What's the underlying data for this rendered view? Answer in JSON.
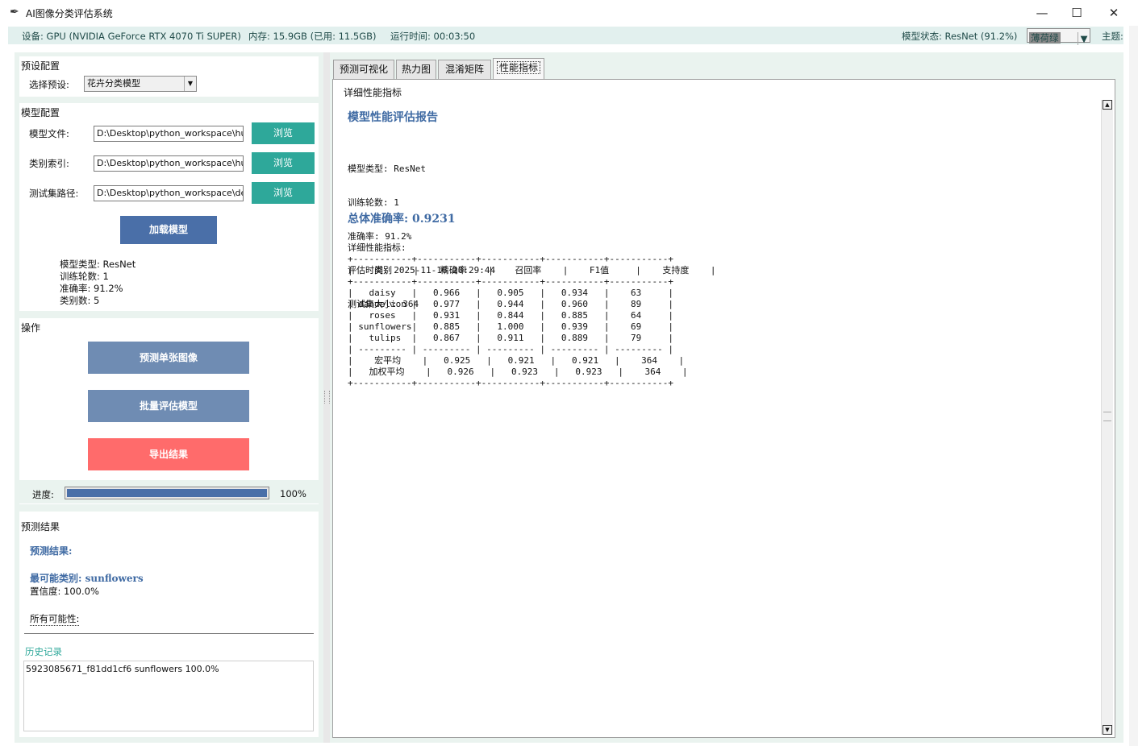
{
  "window": {
    "title": "AI图像分类评估系统",
    "controls": {
      "minimize": "—",
      "maximize": "☐",
      "close": "✕"
    }
  },
  "status": {
    "device": "设备: GPU (NVIDIA GeForce RTX 4070 Ti SUPER)",
    "memory": "内存: 15.9GB (已用: 11.5GB)",
    "runtime": "运行时间: 00:03:50",
    "model_state": "模型状态: ResNet (91.2%)",
    "theme_value": "薄荷绿",
    "theme_label": "主题:"
  },
  "preset": {
    "section": "预设配置",
    "label": "选择预设:",
    "value": "花卉分类模型"
  },
  "model_config": {
    "section": "模型配置",
    "rows": [
      {
        "label": "模型文件:",
        "value": "D:\\Desktop\\python_workspace\\hu",
        "button": "浏览"
      },
      {
        "label": "类别索引:",
        "value": "D:\\Desktop\\python_workspace\\hu",
        "button": "浏览"
      },
      {
        "label": "测试集路径:",
        "value": "D:\\Desktop\\python_workspace\\de",
        "button": "浏览"
      }
    ],
    "load_button": "加载模型",
    "info": [
      "模型类型: ResNet",
      "训练轮数: 1",
      "准确率: 91.2%",
      "类别数: 5"
    ]
  },
  "operations": {
    "section": "操作",
    "predict_button": "预测单张图像",
    "batch_button": "批量评估模型",
    "export_button": "导出结果",
    "progress_label": "进度:",
    "progress_fraction": 1.0,
    "progress_text": "100%"
  },
  "prediction": {
    "section": "预测结果",
    "heading": "预测结果:",
    "top_class": "最可能类别: sunflowers",
    "confidence": "置信度: 100.0%",
    "all_label": "所有可能性:"
  },
  "history": {
    "section": "历史记录",
    "items": [
      "5923085671_f81dd1cf6 sunflowers 100.0%"
    ]
  },
  "tabs": [
    {
      "label": "预测可视化",
      "selected": false
    },
    {
      "label": "热力图",
      "selected": false
    },
    {
      "label": "混淆矩阵",
      "selected": false
    },
    {
      "label": "性能指标",
      "selected": true
    }
  ],
  "metrics": {
    "frame_label": "详细性能指标",
    "report_title": "模型性能评估报告",
    "meta": [
      "模型类型: ResNet",
      "训练轮数: 1",
      "准确率: 91.2%",
      "评估时间: 2025-11-16 20:29:44",
      "测试集大小: 364"
    ],
    "overall": "总体准确率: 0.9231",
    "detail_label": "详细性能指标:",
    "table_text": "+-----------+-----------+-----------+-----------+-----------+\n|    类别    |    精确率    |    召回率    |    F1值     |    支持度    |\n+-----------+-----------+-----------+-----------+-----------+\n|   daisy   |   0.966   |   0.905   |   0.934   |    63     |\n| dandelion |   0.977   |   0.944   |   0.960   |    89     |\n|   roses   |   0.931   |   0.844   |   0.885   |    64     |\n| sunflowers|   0.885   |   1.000   |   0.939   |    69     |\n|   tulips  |   0.867   |   0.911   |   0.889   |    79     |\n| --------- | --------- | --------- | --------- | --------- |\n|    宏平均    |   0.925   |   0.921   |   0.921   |    364    |\n|   加权平均    |   0.926   |   0.923   |   0.923   |    364    |\n+-----------+-----------+-----------+-----------+-----------+"
  },
  "colors": {
    "teal_button": "#2ea89a",
    "blue_button": "#4a6fa8",
    "slate_button": "#6f8cb3",
    "export_button": "#ff6b6b",
    "accent_text": "#3f6aa3",
    "status_bg": "#e2f0ee"
  }
}
